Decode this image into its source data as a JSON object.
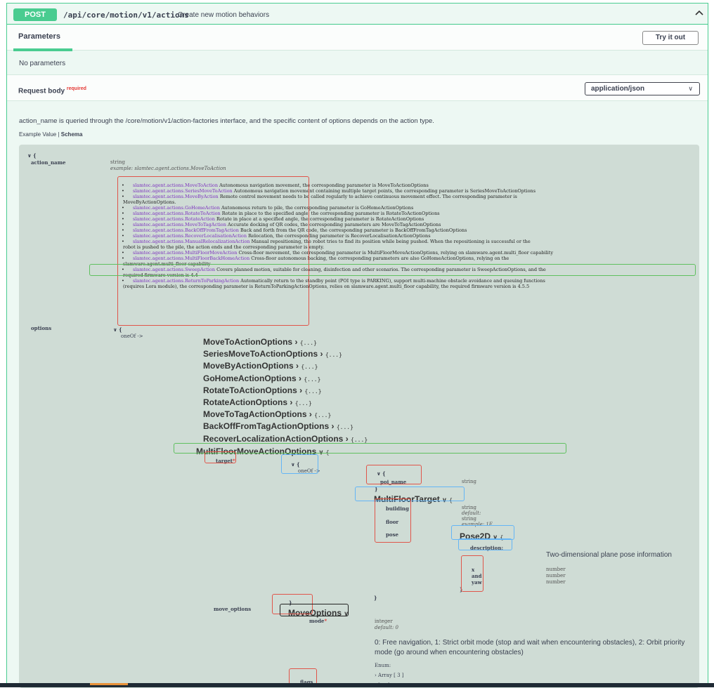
{
  "endpoint": {
    "method": "POST",
    "path": "/api/core/motion/v1/actions",
    "description": "Create new motion behaviors",
    "collapse_icon": "chevron-up-icon"
  },
  "parameters": {
    "tab_label": "Parameters",
    "try_button": "Try it out",
    "empty_text": "No parameters"
  },
  "request_body": {
    "label": "Request body",
    "required_label": "required",
    "content_type": "application/json",
    "description": "action_name is queried through the /core/motion/v1/action-factories interface, and the specific content of options depends on the action type.",
    "tab_example": "Example Value",
    "tab_separator": "|",
    "tab_schema": "Schema"
  },
  "schema": {
    "open": "∨ {",
    "action_name": {
      "name": "action_name",
      "type": "string",
      "example": "example: slamtec.agent.actions.MoveToAction"
    },
    "enum_items": [
      {
        "name": "slamtec.agent.actions.MoveToAction",
        "desc": "Autonomous navigation movement, the corresponding parameter is MoveToActionOptions"
      },
      {
        "name": "slamtec.agent.actions.SeriesMoveToAction",
        "desc": "Autonomous navigation movement containing multiple target points, the corresponding parameter is SeriesMoveToActionOptions"
      },
      {
        "name": "slamtec.agent.actions.MoveByAction",
        "desc": "Remote control movement needs to be called regularly to achieve continuous movement effect. The corresponding parameter is",
        "desc2": "MoveByActionOptions."
      },
      {
        "name": "slamtec.agent.actions.GoHomeAction",
        "desc": "Autonomous return to pile, the corresponding parameter is GoHomeActionOptions"
      },
      {
        "name": "slamtec.agent.actions.RotateToAction",
        "desc": "Rotate in place to the specified angle, the corresponding parameter is RotateToActionOptions"
      },
      {
        "name": "slamtec.agent.actions.RotateAction",
        "desc": "Rotate in place at a specified angle, the corresponding parameter is RotateActionOptions"
      },
      {
        "name": "slamtec.agent.actions.MoveToTagAction",
        "desc": "Accurate docking of QR codes, the corresponding parameters are MoveToTagActionOptions"
      },
      {
        "name": "slamtec.agent.actions.BackOffFromTagAction",
        "desc": "Back and forth from the QR code, the corresponding parameter is BackOffFromTagActionOptions"
      },
      {
        "name": "slamtec.agent.actions.RecoverLocalisationAction",
        "desc": "Relocation, the corresponding parameter is RecoverLocalisationActionOptions"
      },
      {
        "name": "slamtec.agent.actions.ManualRelocalizationAction",
        "desc": "Manual repositioning, the robot tries to find its position while being pushed. When the repositioning is successful or the",
        "desc2": "robot is pushed to the pile, the action ends and the corresponding parameter is empty."
      },
      {
        "name": "slamtec.agent.actions.MultiFloorMoveAction",
        "desc": "Cross-floor movement, the corresponding parameter is MultiFloorMoveActionOptions, relying on slamware.agent.multi_floor capability"
      },
      {
        "name": "slamtec.agent.actions.MultiFloorBackHomeAction",
        "desc": "Cross-floor autonomous backing, the corresponding parameters are also GoHomeActionOptions, relying on the",
        "desc2": "slamware.agent.multi_floor capability"
      },
      {
        "name": "slamtec.agent.actions.SweepAction",
        "desc": "Covers planned motion, suitable for cleaning, disinfection and other scenarios. The corresponding parameter is SweepActionOptions, and the",
        "desc2": "required firmware version is 4.4"
      },
      {
        "name": "slamtec.agent.actions.ReturnToParkingAction",
        "desc": "Automatically return to the standby point (POI type is PARKING), support multi-machine obstacle avoidance and queuing functions",
        "desc2": "(requires Lora module), the corresponding parameter is ReturnToParkingActionOptions, relies on slamware.agent.multi_floor capability, the required firmware version is 4.5.5"
      }
    ],
    "options": {
      "name": "options",
      "open": "∨ {",
      "oneof": "oneOf ->",
      "list": [
        {
          "name": "MoveToActionOptions",
          "arrow": "›",
          "brace": "{...}"
        },
        {
          "name": "SeriesMoveToActionOptions",
          "arrow": "›",
          "brace": "{...}"
        },
        {
          "name": "MoveByActionOptions",
          "arrow": "›",
          "brace": "{...}"
        },
        {
          "name": "GoHomeActionOptions",
          "arrow": "›",
          "brace": "{...}"
        },
        {
          "name": "RotateToActionOptions",
          "arrow": "›",
          "brace": "{...}"
        },
        {
          "name": "RotateActionOptions",
          "arrow": "›",
          "brace": "{...}"
        },
        {
          "name": "MoveToTagActionOptions",
          "arrow": "›",
          "brace": "{...}"
        },
        {
          "name": "BackOffFromTagActionOptions",
          "arrow": "›",
          "brace": "{...}"
        },
        {
          "name": "RecoverLocalizationActionOptions",
          "arrow": "›",
          "brace": "{...}"
        }
      ],
      "expanded": {
        "name": "MultiFloorMoveActionOptions",
        "arrow": "∨",
        "brace": "{"
      }
    },
    "target": {
      "name": "target",
      "required_mark": "*",
      "open": "∨ {",
      "oneof": "oneOf ->",
      "poi_open": "∨ {",
      "poi_name": "poi_name",
      "poi_type": "string",
      "poi_close": "}",
      "multi_floor_target": "MultiFloorTarget",
      "mft_arrow": "∨",
      "mft_brace": "{",
      "building": "building",
      "floor": "floor",
      "pose": "pose",
      "building_type": "string",
      "building_default": "default:",
      "floor_type": "string",
      "floor_example": "example: 1F",
      "pose2d": "Pose2D",
      "pose2d_arrow": "∨",
      "pose2d_brace": "{",
      "description_key": "description:",
      "description_text": "Two-dimensional plane pose information",
      "x": "x",
      "and": "and",
      "yaw": "yaw",
      "num1": "number",
      "num2": "number",
      "num3": "number",
      "close1": "}",
      "close2": "}"
    },
    "move_options": {
      "name": "move_options",
      "close": "}",
      "type_name": "MoveOptions",
      "arrow": "∨",
      "mode": "mode",
      "required_mark": "*",
      "mode_type": "integer",
      "mode_default": "default: 0",
      "mode_desc": "0: Free navigation, 1: Strict orbit mode (stop and wait when encountering obstacles), 2: Orbit priority mode (go around when encountering obstacles)",
      "enum_label": "Enum:",
      "array_item": "› Array [ 3 ]",
      "array_item2": "› [ ... ]",
      "flags": "flags"
    }
  }
}
